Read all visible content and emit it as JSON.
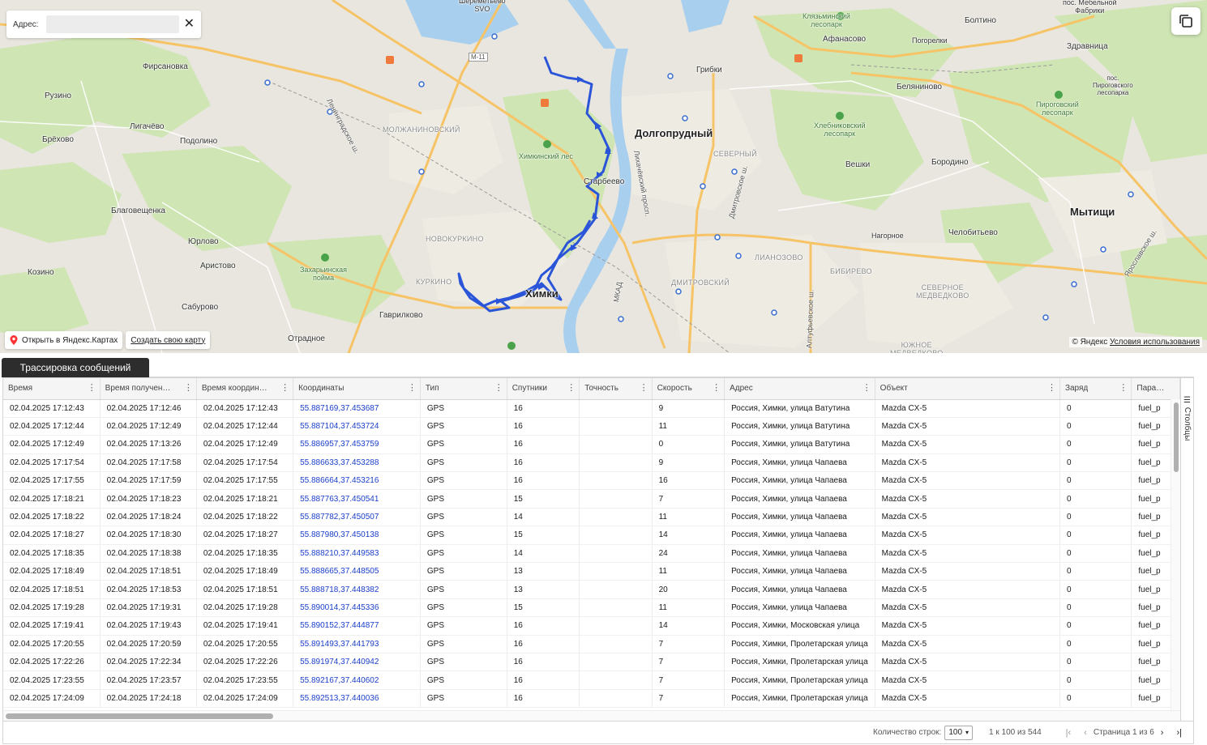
{
  "map": {
    "address_label": "Адрес:",
    "address_value": "",
    "open_yandex": "Открыть в Яндекс.Картах",
    "create_map": "Создать свою карту",
    "copyright": "© Яндекс",
    "terms": "Условия использования",
    "labels": {
      "sheremetyevo": "Шереметьево\nSVO",
      "firsanovka": "Фирсановка",
      "ruzino": "Рузино",
      "ligachevo": "Лигачёво",
      "brekhovo": "Брёхово",
      "podolino": "Подолино",
      "blagoveshchenka": "Благовещенка",
      "yurlovo": "Юрлово",
      "aristovo": "Аристово",
      "kozino": "Козино",
      "sabourovo": "Сабурово",
      "otradnoe": "Отрадное",
      "gavrilkovo": "Гаврилково",
      "zakharkovskaya": "Захарьинская\nпойма",
      "khimki_forest": "Химкинский лес",
      "molzhaninovsky": "МОЛЖАНИНОВСКИЙ",
      "novokurkino": "НОВОКУРКИНО",
      "kurkino": "КУРКИНО",
      "khimki": "Химки",
      "starbeevo": "Старбеево",
      "dolgoprudny": "Долгопрудный",
      "severny": "СЕВЕРНЫЙ",
      "lianozovo": "ЛИАНОЗОВО",
      "bibirevo": "БИБИРЕВО",
      "dmitrovsky": "ДМИТРОВСКИЙ",
      "severnoe_medvedkovo": "СЕВЕРНОЕ\nМЕДВЕДКОВО",
      "yuzhnoe_medvedkovo": "ЮЖНОЕ\nМЕДВЕДКОВО",
      "gribki": "Грибки",
      "afanasovo": "Афанасово",
      "klyazminsky": "Клязьминский\nлесопарк",
      "boltino": "Болтино",
      "pogorelki": "Погорелки",
      "zdravnitsa": "Здравница",
      "mebelnoy": "пос. Мебельной\nФабрики",
      "belyaninovo": "Беляниново",
      "pirogovsky_pos": "пос.\nПироговского\nлесопарка",
      "pirogovsky": "Пироговский\nлесопарк",
      "khlebnikovsky": "Хлебниковский\nлесопарк",
      "veshki": "Вешки",
      "borodino": "Бородино",
      "mytishchi": "Мытищи",
      "nagornoe": "Нагорное",
      "chelobitevo": "Челобитьево",
      "m11": "М-11",
      "leningradskoe": "Ленинградское ш.",
      "likhachevsky": "Лихачёвский просп.",
      "altufevskoe": "Алтуфьевское ш.",
      "dmitrovskoe": "Дмитровское ш.",
      "mkad": "МКАД",
      "yaroslavskoe": "Ярославское ш."
    }
  },
  "panel": {
    "tab_label": "Трассировка сообщений",
    "columns_label": "Столбцы",
    "headers": [
      "Время",
      "Время получен…",
      "Время координ…",
      "Координаты",
      "Тип",
      "Спутники",
      "Точность",
      "Скорость",
      "Адрес",
      "Объект",
      "Заряд",
      "Парамет"
    ],
    "rows": [
      [
        "02.04.2025 17:12:43",
        "02.04.2025 17:12:46",
        "02.04.2025 17:12:43",
        "55.887169,37.453687",
        "GPS",
        "16",
        "",
        "9",
        "Россия, Химки, улица Ватутина",
        "Mazda CX-5",
        "0",
        "fuel_p"
      ],
      [
        "02.04.2025 17:12:44",
        "02.04.2025 17:12:49",
        "02.04.2025 17:12:44",
        "55.887104,37.453724",
        "GPS",
        "16",
        "",
        "11",
        "Россия, Химки, улица Ватутина",
        "Mazda CX-5",
        "0",
        "fuel_p"
      ],
      [
        "02.04.2025 17:12:49",
        "02.04.2025 17:13:26",
        "02.04.2025 17:12:49",
        "55.886957,37.453759",
        "GPS",
        "16",
        "",
        "0",
        "Россия, Химки, улица Ватутина",
        "Mazda CX-5",
        "0",
        "fuel_p"
      ],
      [
        "02.04.2025 17:17:54",
        "02.04.2025 17:17:58",
        "02.04.2025 17:17:54",
        "55.886633,37.453288",
        "GPS",
        "16",
        "",
        "9",
        "Россия, Химки, улица Чапаева",
        "Mazda CX-5",
        "0",
        "fuel_p"
      ],
      [
        "02.04.2025 17:17:55",
        "02.04.2025 17:17:59",
        "02.04.2025 17:17:55",
        "55.886664,37.453216",
        "GPS",
        "16",
        "",
        "16",
        "Россия, Химки, улица Чапаева",
        "Mazda CX-5",
        "0",
        "fuel_p"
      ],
      [
        "02.04.2025 17:18:21",
        "02.04.2025 17:18:23",
        "02.04.2025 17:18:21",
        "55.887763,37.450541",
        "GPS",
        "15",
        "",
        "7",
        "Россия, Химки, улица Чапаева",
        "Mazda CX-5",
        "0",
        "fuel_p"
      ],
      [
        "02.04.2025 17:18:22",
        "02.04.2025 17:18:24",
        "02.04.2025 17:18:22",
        "55.887782,37.450507",
        "GPS",
        "14",
        "",
        "11",
        "Россия, Химки, улица Чапаева",
        "Mazda CX-5",
        "0",
        "fuel_p"
      ],
      [
        "02.04.2025 17:18:27",
        "02.04.2025 17:18:30",
        "02.04.2025 17:18:27",
        "55.887980,37.450138",
        "GPS",
        "15",
        "",
        "14",
        "Россия, Химки, улица Чапаева",
        "Mazda CX-5",
        "0",
        "fuel_p"
      ],
      [
        "02.04.2025 17:18:35",
        "02.04.2025 17:18:38",
        "02.04.2025 17:18:35",
        "55.888210,37.449583",
        "GPS",
        "14",
        "",
        "24",
        "Россия, Химки, улица Чапаева",
        "Mazda CX-5",
        "0",
        "fuel_p"
      ],
      [
        "02.04.2025 17:18:49",
        "02.04.2025 17:18:51",
        "02.04.2025 17:18:49",
        "55.888665,37.448505",
        "GPS",
        "13",
        "",
        "11",
        "Россия, Химки, улица Чапаева",
        "Mazda CX-5",
        "0",
        "fuel_p"
      ],
      [
        "02.04.2025 17:18:51",
        "02.04.2025 17:18:53",
        "02.04.2025 17:18:51",
        "55.888718,37.448382",
        "GPS",
        "13",
        "",
        "20",
        "Россия, Химки, улица Чапаева",
        "Mazda CX-5",
        "0",
        "fuel_p"
      ],
      [
        "02.04.2025 17:19:28",
        "02.04.2025 17:19:31",
        "02.04.2025 17:19:28",
        "55.890014,37.445336",
        "GPS",
        "15",
        "",
        "11",
        "Россия, Химки, улица Чапаева",
        "Mazda CX-5",
        "0",
        "fuel_p"
      ],
      [
        "02.04.2025 17:19:41",
        "02.04.2025 17:19:43",
        "02.04.2025 17:19:41",
        "55.890152,37.444877",
        "GPS",
        "16",
        "",
        "14",
        "Россия, Химки, Московская улица",
        "Mazda CX-5",
        "0",
        "fuel_p"
      ],
      [
        "02.04.2025 17:20:55",
        "02.04.2025 17:20:59",
        "02.04.2025 17:20:55",
        "55.891493,37.441793",
        "GPS",
        "16",
        "",
        "7",
        "Россия, Химки, Пролетарская улица",
        "Mazda CX-5",
        "0",
        "fuel_p"
      ],
      [
        "02.04.2025 17:22:26",
        "02.04.2025 17:22:34",
        "02.04.2025 17:22:26",
        "55.891974,37.440942",
        "GPS",
        "16",
        "",
        "7",
        "Россия, Химки, Пролетарская улица",
        "Mazda CX-5",
        "0",
        "fuel_p"
      ],
      [
        "02.04.2025 17:23:55",
        "02.04.2025 17:23:57",
        "02.04.2025 17:23:55",
        "55.892167,37.440602",
        "GPS",
        "16",
        "",
        "7",
        "Россия, Химки, Пролетарская улица",
        "Mazda CX-5",
        "0",
        "fuel_p"
      ],
      [
        "02.04.2025 17:24:09",
        "02.04.2025 17:24:18",
        "02.04.2025 17:24:09",
        "55.892513,37.440036",
        "GPS",
        "16",
        "",
        "7",
        "Россия, Химки, Пролетарская улица",
        "Mazda CX-5",
        "0",
        "fuel_p"
      ]
    ],
    "pager": {
      "rows_label": "Количество строк:",
      "rows_value": "100",
      "range": "1 к 100 из 544",
      "page": "Страница 1 из 6"
    }
  },
  "colors": {
    "track": "#2b55d8",
    "link": "#1a3fc9",
    "tab_bg": "#2d2d2d"
  }
}
